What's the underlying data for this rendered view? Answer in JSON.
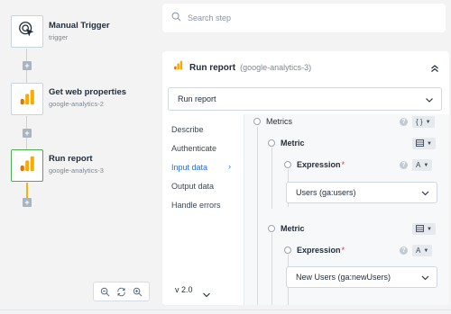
{
  "workflow": {
    "nodes": [
      {
        "title": "Manual Trigger",
        "subtitle": "trigger",
        "icon": "cursor-click-icon"
      },
      {
        "title": "Get web properties",
        "subtitle": "google-analytics-2",
        "icon": "google-analytics-icon"
      },
      {
        "title": "Run report",
        "subtitle": "google-analytics-3",
        "icon": "google-analytics-icon"
      }
    ],
    "add_step_label": "+"
  },
  "search": {
    "placeholder": "Search step"
  },
  "panel": {
    "title": "Run report",
    "subtitle": "(google-analytics-3)",
    "action_select": "Run report",
    "tabs": [
      "Describe",
      "Authenticate",
      "Input data",
      "Output data",
      "Handle errors"
    ],
    "active_tab": "Input data",
    "version": "v 2.0"
  },
  "input": {
    "metrics_label": "Metrics",
    "metrics_type": "{ }",
    "metric_blocks": [
      {
        "label": "Metric",
        "expression_label": "Expression",
        "required_mark": "*",
        "expression_type": "A",
        "value": "Users (ga:users)"
      },
      {
        "label": "Metric",
        "expression_label": "Expression",
        "required_mark": "*",
        "expression_type": "A",
        "value": "New Users (ga:newUsers)"
      }
    ]
  },
  "colors": {
    "accent": "#2f6fd6",
    "active_node": "#4cae4f",
    "ga_orange": "#f9ab00",
    "ga_dark": "#e37400",
    "required": "#e53935"
  }
}
